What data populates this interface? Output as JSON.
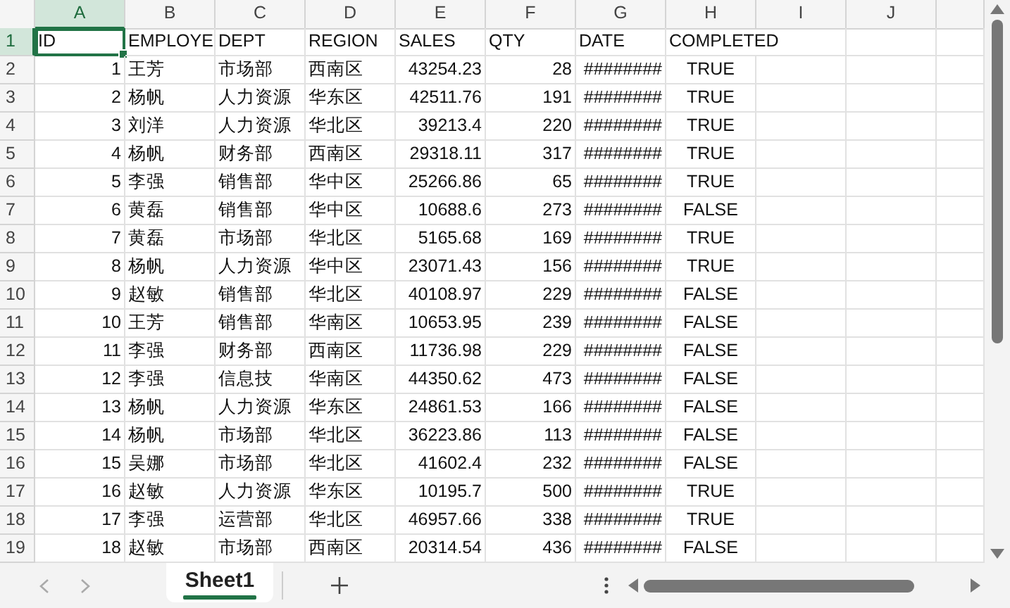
{
  "columns": [
    {
      "label": "A",
      "kind": "number",
      "selected": true
    },
    {
      "label": "B",
      "kind": "text",
      "selected": false
    },
    {
      "label": "C",
      "kind": "text",
      "selected": false
    },
    {
      "label": "D",
      "kind": "text",
      "selected": false
    },
    {
      "label": "E",
      "kind": "number",
      "selected": false
    },
    {
      "label": "F",
      "kind": "number",
      "selected": false
    },
    {
      "label": "G",
      "kind": "number",
      "selected": false
    },
    {
      "label": "H",
      "kind": "boolean",
      "selected": false
    },
    {
      "label": "I",
      "kind": "text",
      "selected": false
    },
    {
      "label": "J",
      "kind": "text",
      "selected": false
    }
  ],
  "rows": [
    {
      "number": "1",
      "kind": "header",
      "selected": true,
      "cells": [
        "ID",
        "EMPLOYE",
        "DEPT",
        "REGION",
        "SALES",
        "QTY",
        "DATE",
        "COMPLETED"
      ]
    },
    {
      "number": "2",
      "kind": "data",
      "selected": false,
      "cells": [
        "1",
        "王芳",
        "市场部",
        "西南区",
        "43254.23",
        "28",
        "########",
        "TRUE"
      ]
    },
    {
      "number": "3",
      "kind": "data",
      "selected": false,
      "cells": [
        "2",
        "杨帆",
        "人力资源",
        "华东区",
        "42511.76",
        "191",
        "########",
        "TRUE"
      ]
    },
    {
      "number": "4",
      "kind": "data",
      "selected": false,
      "cells": [
        "3",
        "刘洋",
        "人力资源",
        "华北区",
        "39213.4",
        "220",
        "########",
        "TRUE"
      ]
    },
    {
      "number": "5",
      "kind": "data",
      "selected": false,
      "cells": [
        "4",
        "杨帆",
        "财务部",
        "西南区",
        "29318.11",
        "317",
        "########",
        "TRUE"
      ]
    },
    {
      "number": "6",
      "kind": "data",
      "selected": false,
      "cells": [
        "5",
        "李强",
        "销售部",
        "华中区",
        "25266.86",
        "65",
        "########",
        "TRUE"
      ]
    },
    {
      "number": "7",
      "kind": "data",
      "selected": false,
      "cells": [
        "6",
        "黄磊",
        "销售部",
        "华中区",
        "10688.6",
        "273",
        "########",
        "FALSE"
      ]
    },
    {
      "number": "8",
      "kind": "data",
      "selected": false,
      "cells": [
        "7",
        "黄磊",
        "市场部",
        "华北区",
        "5165.68",
        "169",
        "########",
        "TRUE"
      ]
    },
    {
      "number": "9",
      "kind": "data",
      "selected": false,
      "cells": [
        "8",
        "杨帆",
        "人力资源",
        "华中区",
        "23071.43",
        "156",
        "########",
        "TRUE"
      ]
    },
    {
      "number": "10",
      "kind": "data",
      "selected": false,
      "cells": [
        "9",
        "赵敏",
        "销售部",
        "华北区",
        "40108.97",
        "229",
        "########",
        "FALSE"
      ]
    },
    {
      "number": "11",
      "kind": "data",
      "selected": false,
      "cells": [
        "10",
        "王芳",
        "销售部",
        "华南区",
        "10653.95",
        "239",
        "########",
        "FALSE"
      ]
    },
    {
      "number": "12",
      "kind": "data",
      "selected": false,
      "cells": [
        "11",
        "李强",
        "财务部",
        "西南区",
        "11736.98",
        "229",
        "########",
        "FALSE"
      ]
    },
    {
      "number": "13",
      "kind": "data",
      "selected": false,
      "cells": [
        "12",
        "李强",
        "信息技",
        "华南区",
        "44350.62",
        "473",
        "########",
        "FALSE"
      ]
    },
    {
      "number": "14",
      "kind": "data",
      "selected": false,
      "cells": [
        "13",
        "杨帆",
        "人力资源",
        "华东区",
        "24861.53",
        "166",
        "########",
        "FALSE"
      ]
    },
    {
      "number": "15",
      "kind": "data",
      "selected": false,
      "cells": [
        "14",
        "杨帆",
        "市场部",
        "华北区",
        "36223.86",
        "113",
        "########",
        "FALSE"
      ]
    },
    {
      "number": "16",
      "kind": "data",
      "selected": false,
      "cells": [
        "15",
        "吴娜",
        "市场部",
        "华北区",
        "41602.4",
        "232",
        "########",
        "FALSE"
      ]
    },
    {
      "number": "17",
      "kind": "data",
      "selected": false,
      "cells": [
        "16",
        "赵敏",
        "人力资源",
        "华东区",
        "10195.7",
        "500",
        "########",
        "TRUE"
      ]
    },
    {
      "number": "18",
      "kind": "data",
      "selected": false,
      "cells": [
        "17",
        "李强",
        "运营部",
        "华北区",
        "46957.66",
        "338",
        "########",
        "TRUE"
      ]
    },
    {
      "number": "19",
      "kind": "data",
      "selected": false,
      "cells": [
        "18",
        "赵敏",
        "市场部",
        "西南区",
        "20314.54",
        "436",
        "########",
        "FALSE"
      ]
    }
  ],
  "sheet_tabs": [
    {
      "label": "Sheet1",
      "selected": true
    }
  ]
}
